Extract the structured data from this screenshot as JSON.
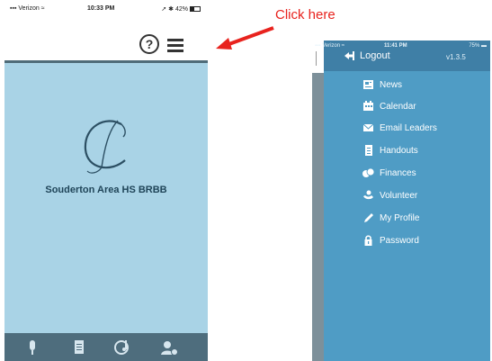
{
  "left_phone": {
    "status": {
      "carrier": "Verizon",
      "time": "10:33 PM",
      "battery": "42%"
    },
    "header": {
      "help_icon": "question-circle-icon",
      "menu_icon": "hamburger-menu-icon"
    },
    "organization_name": "Souderton Area HS BRBB",
    "bottom_nav": [
      {
        "icon": "microphone-icon"
      },
      {
        "icon": "document-icon"
      },
      {
        "icon": "music-calendar-icon"
      },
      {
        "icon": "user-gear-icon"
      }
    ],
    "colors": {
      "main_bg": "#a9d3e6",
      "bar": "#4e6d7d"
    }
  },
  "annotation": {
    "text": "Click here",
    "color": "#e8231e"
  },
  "right_phone": {
    "status": {
      "carrier": "Verizon",
      "time": "11:41 PM",
      "battery": "75%"
    },
    "drawer": {
      "logout_label": "Logout",
      "version": "v1.3.5",
      "items": [
        {
          "label": "News",
          "icon": "newspaper-icon"
        },
        {
          "label": "Calendar",
          "icon": "calendar-icon"
        },
        {
          "label": "Email Leaders",
          "icon": "envelope-icon"
        },
        {
          "label": "Handouts",
          "icon": "file-icon"
        },
        {
          "label": "Finances",
          "icon": "coins-icon"
        },
        {
          "label": "Volunteer",
          "icon": "handshake-icon"
        },
        {
          "label": "My Profile",
          "icon": "pencil-icon"
        },
        {
          "label": "Password",
          "icon": "lock-icon"
        }
      ]
    },
    "colors": {
      "drawer_bg": "#4f9cc5",
      "drawer_head": "#3f7fa6"
    }
  }
}
